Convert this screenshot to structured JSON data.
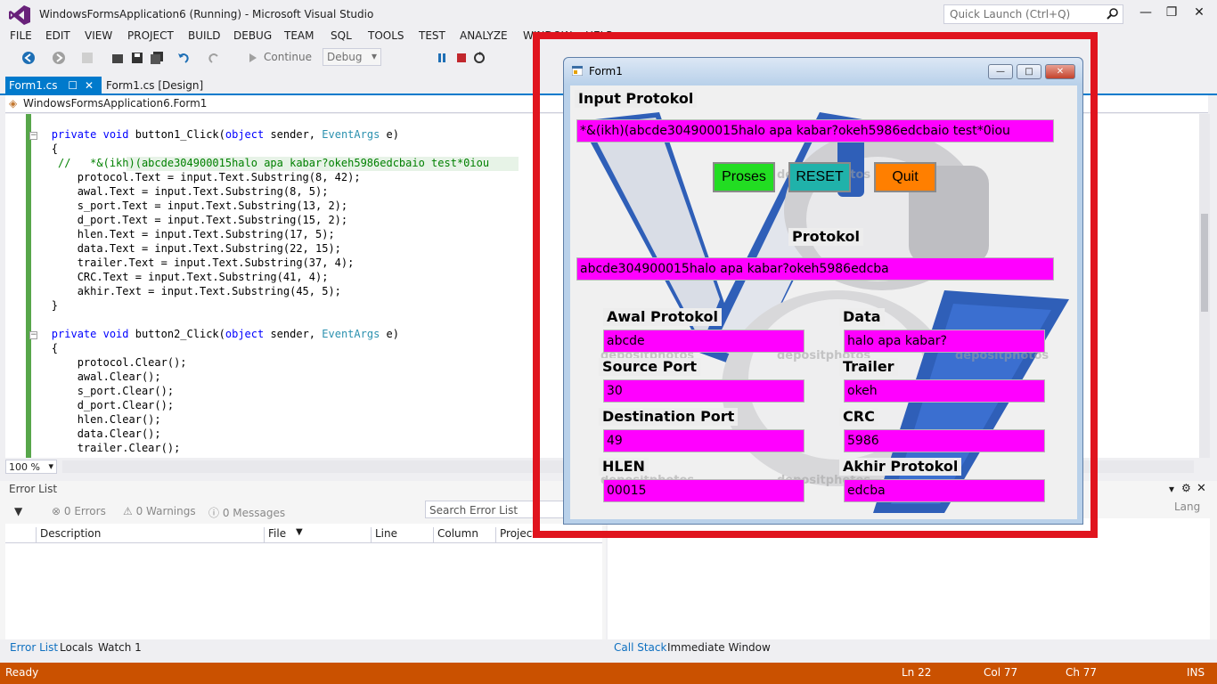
{
  "titlebar": {
    "title": "WindowsFormsApplication6 (Running) - Microsoft Visual Studio",
    "quick_launch_placeholder": "Quick Launch (Ctrl+Q)"
  },
  "menu": [
    "FILE",
    "EDIT",
    "VIEW",
    "PROJECT",
    "BUILD",
    "DEBUG",
    "TEAM",
    "SQL",
    "TOOLS",
    "TEST",
    "ANALYZE",
    "WINDOW",
    "HELP"
  ],
  "toolbar": {
    "continue_label": "Continue",
    "config_value": "Debug"
  },
  "tabs": {
    "active": "Form1.cs",
    "second": "Form1.cs [Design]"
  },
  "navbar": {
    "class_path": "WindowsFormsApplication6.Form1"
  },
  "code": {
    "lines": [
      "        private void button1_Click(object sender, EventArgs e)",
      "        {",
      "         //   *&(ikh)(abcde304900015halo apa kabar?okeh5986edcbaio test*0iou",
      "            protocol.Text = input.Text.Substring(8, 42);",
      "            awal.Text = input.Text.Substring(8, 5);",
      "            s_port.Text = input.Text.Substring(13, 2);",
      "            d_port.Text = input.Text.Substring(15, 2);",
      "            hlen.Text = input.Text.Substring(17, 5);",
      "            data.Text = input.Text.Substring(22, 15);",
      "            trailer.Text = input.Text.Substring(37, 4);",
      "            CRC.Text = input.Text.Substring(41, 4);",
      "            akhir.Text = input.Text.Substring(45, 5);",
      "        }",
      "",
      "        private void button2_Click(object sender, EventArgs e)",
      "        {",
      "            protocol.Clear();",
      "            awal.Clear();",
      "            s_port.Clear();",
      "            d_port.Clear();",
      "            hlen.Clear();",
      "            data.Clear();",
      "            trailer.Clear();"
    ]
  },
  "editor_status": {
    "zoom": "100 %"
  },
  "error_list": {
    "title": "Error List",
    "errors": "0 Errors",
    "warnings": "0 Warnings",
    "messages": "0 Messages",
    "search_placeholder": "Search Error List",
    "columns": [
      "Description",
      "File",
      "Line",
      "Column",
      "Project"
    ]
  },
  "right_panel": {
    "search_hint": "Lang"
  },
  "bottom_tabs": {
    "left": [
      "Error List",
      "Locals",
      "Watch 1"
    ],
    "right": [
      "Call Stack",
      "Immediate Window"
    ]
  },
  "statusbar": {
    "state": "Ready",
    "ln": "Ln 22",
    "col": "Col 77",
    "ch": "Ch 77",
    "ins": "INS"
  },
  "form1": {
    "title": "Form1",
    "input_label": "Input Protokol",
    "input_value": "*&(ikh)(abcde304900015halo apa kabar?okeh5986edcbaio test*0iou",
    "btn_proses": "Proses",
    "btn_reset": "RESET",
    "btn_quit": "Quit",
    "protokol_label": "Protokol",
    "protokol_value": "abcde304900015halo apa kabar?okeh5986edcba",
    "awal_label": "Awal Protokol",
    "awal_value": "abcde",
    "data_label": "Data",
    "data_value": "halo apa kabar?",
    "sport_label": "Source Port",
    "sport_value": "30",
    "trailer_label": "Trailer",
    "trailer_value": "okeh",
    "dport_label": "Destination Port",
    "dport_value": "49",
    "crc_label": "CRC",
    "crc_value": "5986",
    "hlen_label": "HLEN",
    "hlen_value": "00015",
    "akhir_label": "Akhir Protokol",
    "akhir_value": "edcba",
    "watermark": "depositphotos"
  },
  "colors": {
    "accent": "#007ACC",
    "statusbar": "#CA5100",
    "highlight_frame": "#E0141E",
    "textbox_fill": "#FF00FF",
    "proses_btn": "#22DD22",
    "reset_btn": "#20B2AA",
    "quit_btn": "#FF7F00"
  }
}
